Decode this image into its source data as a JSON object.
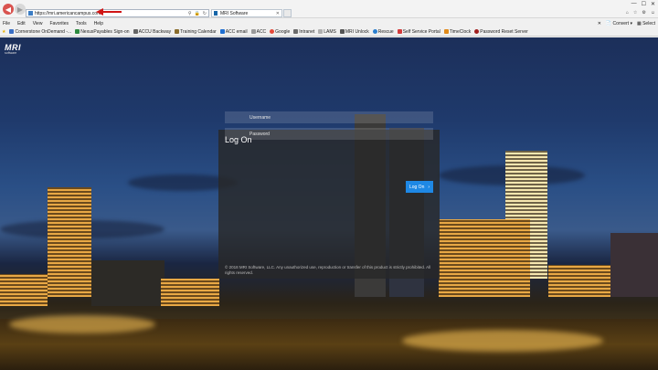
{
  "browser": {
    "url": "https://mri.americancampus.com",
    "tab_title": "MRI Software",
    "menu": [
      "File",
      "Edit",
      "View",
      "Favorites",
      "Tools",
      "Help"
    ],
    "right_tools": {
      "convert": "Convert",
      "select": "Select"
    },
    "favorites": [
      {
        "label": "Cornerstone OnDemand -...",
        "color": "#3a6fc4"
      },
      {
        "label": "NexusPayables Sign-on",
        "color": "#2d8a3f"
      },
      {
        "label": "ACCU Backway",
        "color": "#666666"
      },
      {
        "label": "Training Calendar",
        "color": "#8a6d2d"
      },
      {
        "label": "ACC email",
        "color": "#1f6fd1"
      },
      {
        "label": "ACC",
        "color": "#9a9a9a"
      },
      {
        "label": "Google",
        "color": "#e44a3b"
      },
      {
        "label": "Intranet",
        "color": "#6b6b6b"
      },
      {
        "label": "LAMS",
        "color": "#b0b0b0"
      },
      {
        "label": "MRI Unlock",
        "color": "#555555"
      },
      {
        "label": "Rescue",
        "color": "#2a7fd0"
      },
      {
        "label": "Self Service Portal",
        "color": "#d33c3c"
      },
      {
        "label": "TimeClock",
        "color": "#e08a1a"
      },
      {
        "label": "Password Reset Server",
        "color": "#a01f1f"
      }
    ]
  },
  "page": {
    "logo": {
      "text": "MRI",
      "subtext": "software"
    },
    "login": {
      "title": "Log On",
      "username_placeholder": "Username",
      "password_placeholder": "Password",
      "logon_label": "Log On",
      "copyright": "© 2018 MRI Software, LLC. Any unauthorized use, reproduction or transfer of this product is strictly prohibited. All rights reserved."
    }
  },
  "colors": {
    "accent": "#1e88e5",
    "panel": "#282828"
  }
}
